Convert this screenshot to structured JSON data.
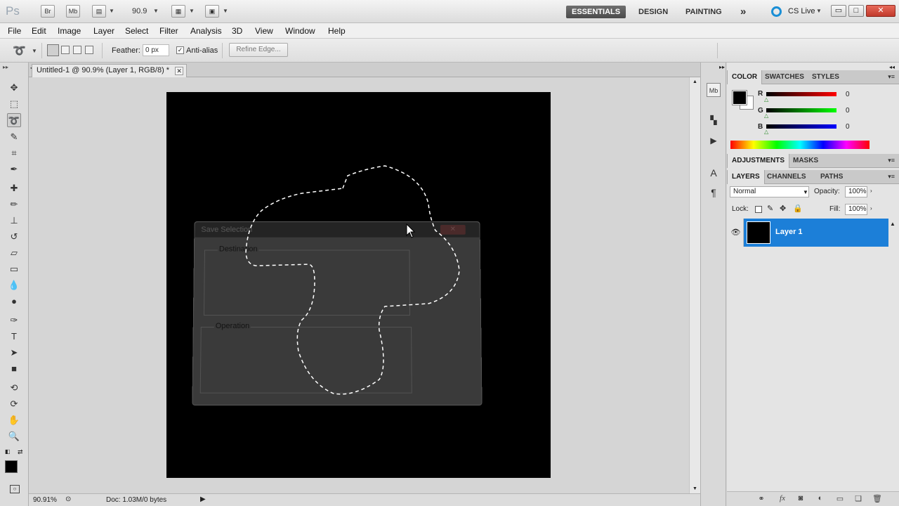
{
  "app": {
    "logo": "Ps",
    "bridge_label": "Br",
    "minibridge_label": "Mb",
    "zoom_value": "90.9",
    "workspaces": [
      "ESSENTIALS",
      "DESIGN",
      "PAINTING"
    ],
    "overflow": "»",
    "cslive": "CS Live",
    "window_buttons": [
      "▭",
      "□",
      "✕"
    ]
  },
  "menu": [
    "File",
    "Edit",
    "Image",
    "Layer",
    "Select",
    "Filter",
    "Analysis",
    "3D",
    "View",
    "Window",
    "Help"
  ],
  "options": {
    "feather_label": "Feather:",
    "feather_value": "0 px",
    "antialias_label": "Anti-alias",
    "antialias_checked": "✓",
    "refine_label": "Refine Edge..."
  },
  "document": {
    "tab_title": "Untitled-1 @ 90.9% (Layer 1, RGB/8) *",
    "tab_close": "✕",
    "status_zoom": "90.91%",
    "status_doc": "Doc: 1.03M/0 bytes",
    "canvas_color": "#000000"
  },
  "ghost_dialog": {
    "title": "Save Selection",
    "close": "✕",
    "group1": "Destination",
    "group2": "Operation"
  },
  "color_panel": {
    "tabs": [
      "COLOR",
      "SWATCHES",
      "STYLES"
    ],
    "channels": [
      {
        "label": "R",
        "value": "0",
        "color": "#e31a1a"
      },
      {
        "label": "G",
        "value": "0",
        "color": "#1ec51e"
      },
      {
        "label": "B",
        "value": "0",
        "color": "#1a2ae3"
      }
    ],
    "foreground": "#000000",
    "background": "#ffffff"
  },
  "adjust_panel": {
    "tabs": [
      "ADJUSTMENTS",
      "MASKS"
    ]
  },
  "layers_panel": {
    "tabs": [
      "LAYERS",
      "CHANNELS",
      "PATHS"
    ],
    "blend_mode": "Normal",
    "opacity_label": "Opacity:",
    "opacity_value": "100%",
    "lock_label": "Lock:",
    "fill_label": "Fill:",
    "fill_value": "100%",
    "layers": [
      {
        "name": "Layer 1",
        "visible": "👁"
      }
    ]
  },
  "tools": [
    "move-tool-icon",
    "marquee-tool-icon",
    "lasso-tool-icon",
    "quick-select-tool-icon",
    "crop-tool-icon",
    "eyedropper-tool-icon",
    "healing-brush-tool-icon",
    "brush-tool-icon",
    "clone-stamp-tool-icon",
    "history-brush-tool-icon",
    "eraser-tool-icon",
    "gradient-tool-icon",
    "blur-tool-icon",
    "dodge-tool-icon",
    "pen-tool-icon",
    "type-tool-icon",
    "path-select-tool-icon",
    "shape-tool-icon",
    "3d-rotate-tool-icon",
    "3d-orbit-tool-icon",
    "hand-tool-icon",
    "zoom-tool-icon"
  ]
}
